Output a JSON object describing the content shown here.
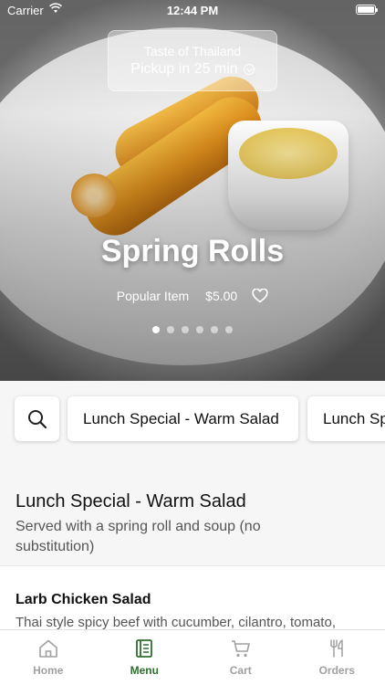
{
  "status_bar": {
    "carrier": "Carrier",
    "time": "12:44 PM"
  },
  "location": {
    "name": "Taste of Thailand",
    "eta": "Pickup in 25 min"
  },
  "hero": {
    "title": "Spring Rolls",
    "tag": "Popular Item",
    "price": "$5.00",
    "slide_count": 6,
    "active_slide": 1
  },
  "categories": [
    {
      "label": "Lunch Special - Warm Salad"
    },
    {
      "label": "Lunch Special - Curry"
    }
  ],
  "section": {
    "title": "Lunch Special - Warm Salad",
    "description": "Served with a spring roll and soup (no substitution)"
  },
  "items": [
    {
      "name": "Larb Chicken Salad",
      "description": "Thai style spicy beef with cucumber, cilantro, tomato,"
    }
  ],
  "tabs": [
    {
      "label": "Home",
      "icon": "home-icon",
      "active": false
    },
    {
      "label": "Menu",
      "icon": "menu-book-icon",
      "active": true
    },
    {
      "label": "Cart",
      "icon": "cart-icon",
      "active": false
    },
    {
      "label": "Orders",
      "icon": "fork-knife-icon",
      "active": false
    }
  ],
  "colors": {
    "accent": "#2e6e2e",
    "inactive": "#a0a0a0"
  }
}
